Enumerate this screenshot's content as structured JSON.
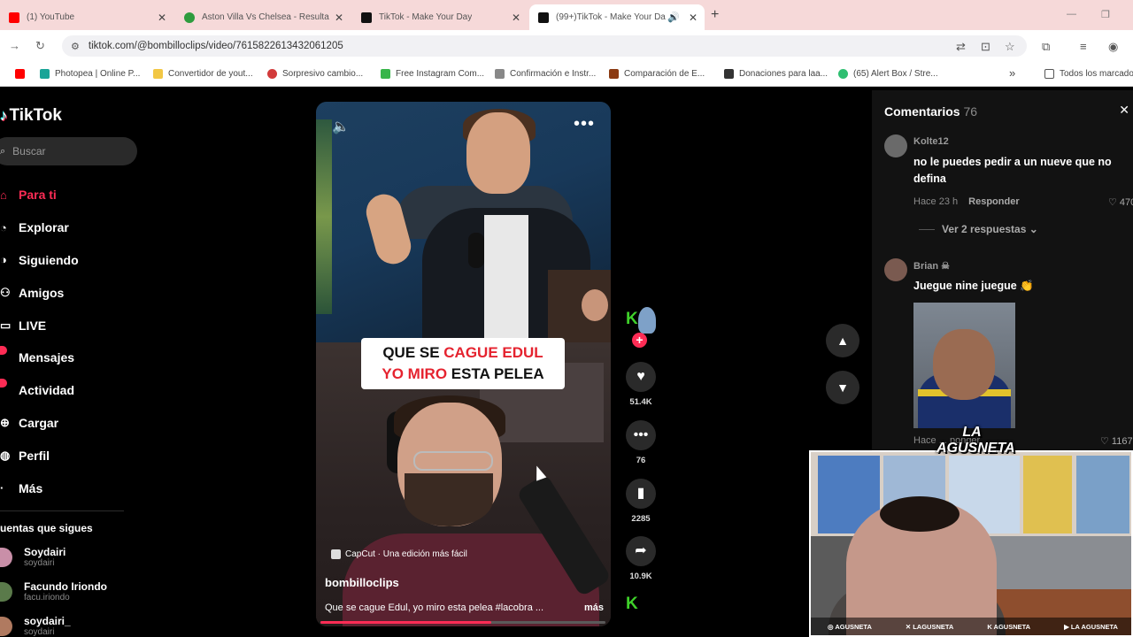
{
  "browser": {
    "tabs": [
      {
        "title": "(1) YouTube",
        "favicon_color": "#ff0000",
        "active": false
      },
      {
        "title": "Aston Villa Vs Chelsea - Resulta",
        "favicon_color": "#2e9c3e",
        "active": false
      },
      {
        "title": "TikTok - Make Your Day",
        "favicon_color": "#111111",
        "active": false
      },
      {
        "title": "(99+)TikTok - Make Your Da",
        "favicon_color": "#111111",
        "active": true
      }
    ],
    "url": "tiktok.com/@bombilloclips/video/7615822613432061205",
    "bookmarks": [
      {
        "label": "",
        "color": "#ff0000"
      },
      {
        "label": "Photopea | Online P...",
        "color": "#18a497"
      },
      {
        "label": "Convertidor de yout...",
        "color": "#f2c744"
      },
      {
        "label": "Sorpresivo cambio...",
        "color": "#d23b3b"
      },
      {
        "label": "Free Instagram Com...",
        "color": "#38b54a"
      },
      {
        "label": "Confirmación e Instr...",
        "color": "#888888"
      },
      {
        "label": "Comparación de E...",
        "color": "#8b3a12"
      },
      {
        "label": "Donaciones para laa...",
        "color": "#333333"
      },
      {
        "label": "(65) Alert Box / Stre...",
        "color": "#2fbf71"
      }
    ],
    "bookmarks_overflow": "»",
    "bookmarks_all": "Todos los marcado"
  },
  "tiktok": {
    "logo": "TikTok",
    "search_placeholder": "Buscar",
    "nav": [
      {
        "label": "Para ti",
        "icon": "home-icon",
        "active": true
      },
      {
        "label": "Explorar",
        "icon": "compass-icon"
      },
      {
        "label": "Siguiendo",
        "icon": "following-icon"
      },
      {
        "label": "Amigos",
        "icon": "friends-icon"
      },
      {
        "label": "LIVE",
        "icon": "live-icon"
      },
      {
        "label": "Mensajes",
        "icon": "messages-icon",
        "badge": true
      },
      {
        "label": "Actividad",
        "icon": "activity-icon",
        "badge": true
      },
      {
        "label": "Cargar",
        "icon": "upload-icon"
      },
      {
        "label": "Perfil",
        "icon": "profile-icon"
      },
      {
        "label": "Más",
        "icon": "more-icon"
      }
    ],
    "following_title": "uentas que sigues",
    "following": [
      {
        "name": "Soydairi",
        "handle": "soydairi",
        "color": "#c98fa8"
      },
      {
        "name": "Facundo Iriondo",
        "handle": "facu.iriondo",
        "color": "#5a7a4a"
      },
      {
        "name": "soydairi_",
        "handle": "soydairi",
        "color": "#b07a60"
      }
    ]
  },
  "video": {
    "caption_line1_plain": "QUE SE ",
    "caption_line1_red": "CAGUE EDUL",
    "caption_line2_red": "YO MIRO",
    "caption_line2_plain": " ESTA PELEA",
    "capcut": "CapCut · Una edición más fácil",
    "author": "bombilloclips",
    "description": "Que se cague Edul, yo miro esta pelea #lacobra ...",
    "more": "más",
    "progress": 0.6
  },
  "actions": {
    "likes": "51.4K",
    "comments": "76",
    "saves": "2285",
    "shares": "10.9K"
  },
  "comments": {
    "title": "Comentarios",
    "count": "76",
    "items": [
      {
        "user": "Kolte12",
        "text": "no le puedes pedir a un nueve que no defina",
        "time": "Hace 23 h",
        "reply": "Responder",
        "likes": "♡ 4704"
      },
      {
        "user": "Brian ☠",
        "text": "Juegue nine juegue 👏",
        "time": "",
        "reply": "",
        "likes": ""
      }
    ],
    "view_replies": "Ver 2 respuestas ⌄",
    "item2_meta": "Hace ... ponder",
    "item2_likes": "♡ 1167"
  },
  "webcam": {
    "logo_line1": "LA",
    "logo_line2": "AGUSNETA",
    "socials": [
      "◎ AGUSNETA",
      "✕ LAGUSNETA",
      "K AGUSNETA",
      "▶ LA AGUSNETA"
    ]
  }
}
